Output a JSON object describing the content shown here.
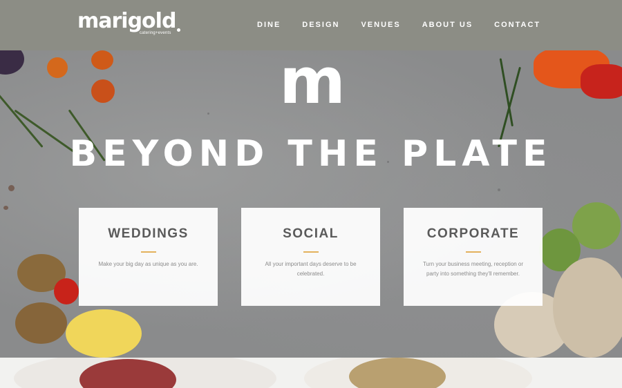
{
  "brand": {
    "name": "marigold",
    "tagline": "catering+events"
  },
  "nav": [
    {
      "label": "DINE"
    },
    {
      "label": "DESIGN"
    },
    {
      "label": "VENUES"
    },
    {
      "label": "ABOUT US"
    },
    {
      "label": "CONTACT"
    }
  ],
  "hero": {
    "monogram": "m",
    "title": "BEYOND THE PLATE"
  },
  "cards": [
    {
      "title": "WEDDINGS",
      "text": "Make your big day as unique as you are."
    },
    {
      "title": "SOCIAL",
      "text": "All your important days deserve to be celebrated."
    },
    {
      "title": "CORPORATE",
      "text": "Turn your business meeting, reception or party into something they'll remember."
    }
  ],
  "colors": {
    "header": "#8c8d85",
    "accent": "#e3b15c",
    "text": "#5a5a5a"
  }
}
